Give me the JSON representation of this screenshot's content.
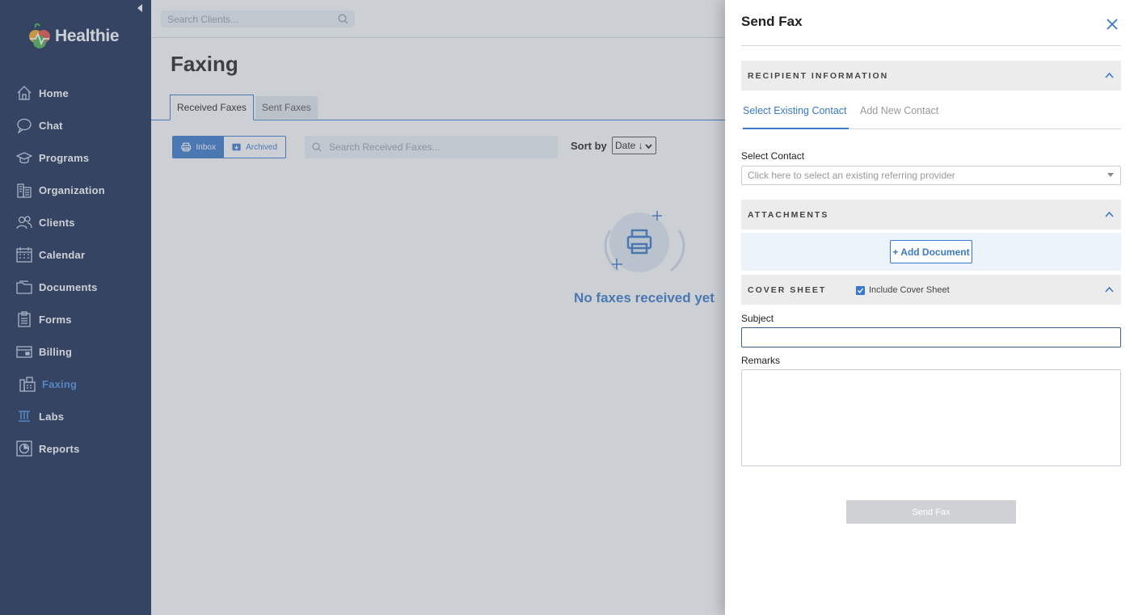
{
  "app": {
    "brand": "Healthie"
  },
  "colors": {
    "sidebar_bg": "#16284f",
    "accent": "#3a78c9",
    "active_nav": "#4a8fe0",
    "overlay": "rgba(110,120,135,0.35)"
  },
  "search": {
    "placeholder": "Search Clients..."
  },
  "sidebar": {
    "items": [
      {
        "label": "Home",
        "icon": "home-icon"
      },
      {
        "label": "Chat",
        "icon": "chat-icon"
      },
      {
        "label": "Programs",
        "icon": "graduation-cap-icon"
      },
      {
        "label": "Organization",
        "icon": "building-icon"
      },
      {
        "label": "Clients",
        "icon": "users-icon"
      },
      {
        "label": "Calendar",
        "icon": "calendar-icon"
      },
      {
        "label": "Documents",
        "icon": "folder-icon"
      },
      {
        "label": "Forms",
        "icon": "clipboard-icon"
      },
      {
        "label": "Billing",
        "icon": "credit-card-icon"
      },
      {
        "label": "Faxing",
        "icon": "fax-icon",
        "active": true
      },
      {
        "label": "Labs",
        "icon": "test-tubes-icon"
      },
      {
        "label": "Reports",
        "icon": "pie-chart-icon"
      }
    ]
  },
  "page": {
    "title": "Faxing",
    "tabs": [
      {
        "label": "Received Faxes",
        "active": true
      },
      {
        "label": "Sent Faxes",
        "active": false
      }
    ],
    "toggle": {
      "inbox": "Inbox",
      "archived": "Archived",
      "selected": "Inbox"
    },
    "search_placeholder": "Search Received Faxes...",
    "sort_label": "Sort by",
    "sort_value": "Date ↓",
    "empty_state": "No faxes received yet"
  },
  "drawer": {
    "title": "Send Fax",
    "recipient_section": "RECIPIENT INFORMATION",
    "contact_tabs": [
      {
        "label": "Select Existing Contact",
        "active": true
      },
      {
        "label": "Add New Contact",
        "active": false
      }
    ],
    "select_contact_label": "Select Contact",
    "select_contact_placeholder": "Click here to select an existing referring provider",
    "attachments_section": "ATTACHMENTS",
    "add_document": "+ Add Document",
    "cover_section": "COVER SHEET",
    "include_cover": "Include Cover Sheet",
    "include_cover_checked": true,
    "subject_label": "Subject",
    "subject_value": "",
    "remarks_label": "Remarks",
    "remarks_value": "",
    "send_button": "Send Fax"
  }
}
